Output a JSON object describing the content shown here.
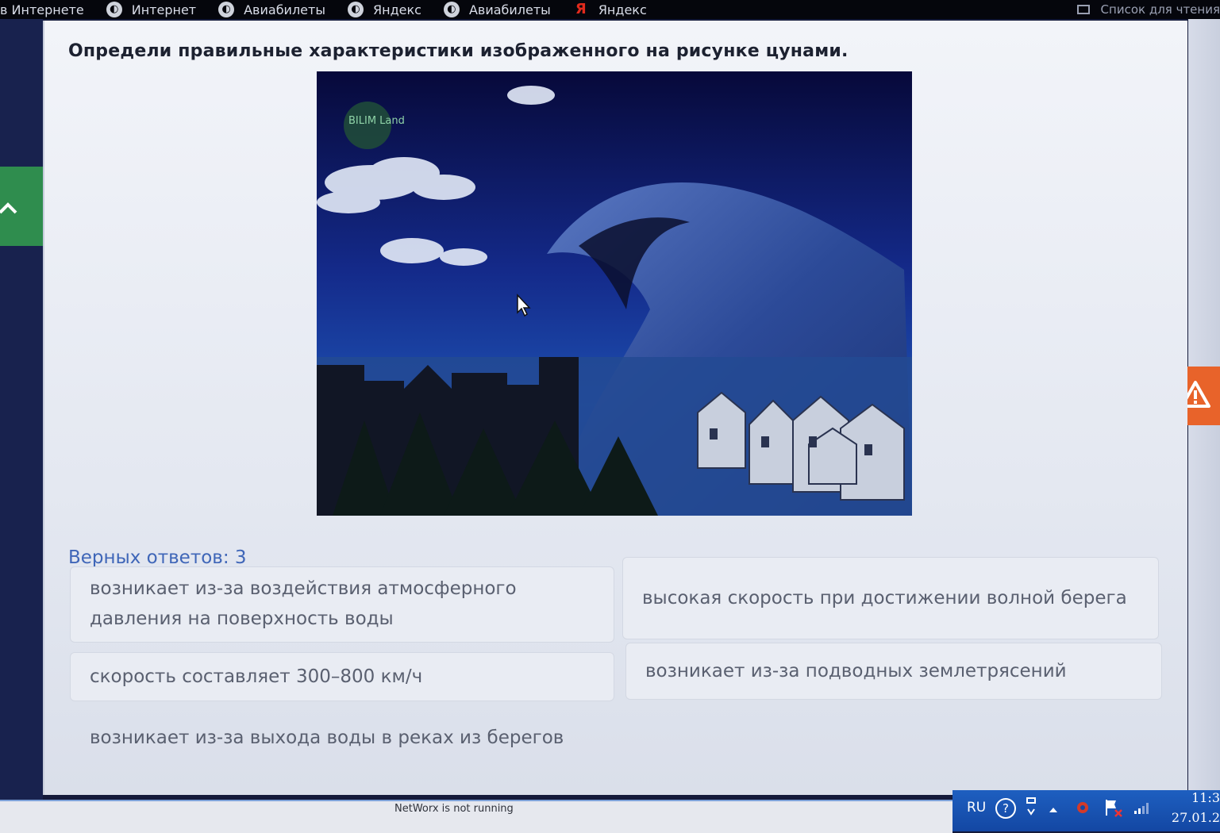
{
  "bookmarks": [
    {
      "label": "в Интернете",
      "icon": "globe-icon"
    },
    {
      "label": "Интернет",
      "icon": "globe-icon"
    },
    {
      "label": "Авиабилеты",
      "icon": "globe-icon"
    },
    {
      "label": "Яндекс",
      "icon": "globe-icon"
    },
    {
      "label": "Авиабилеты",
      "icon": "globe-icon"
    },
    {
      "label": "Яндекс",
      "icon": "yandex-icon"
    }
  ],
  "reading_list": {
    "label": "Список для чтения",
    "icon": "reading-list-icon"
  },
  "quiz": {
    "question": "Определи правильные характеристики изображенного на рисунке цунами.",
    "image_watermark": "BILIM Land",
    "correct_count": "Верных ответов: 3",
    "answers": [
      "возникает из-за воздействия атмосферного давления на поверхность воды",
      "высокая скорость при достижении волной берега",
      "скорость составляет 300–800 км/ч",
      "возникает из-за подводных землетрясений",
      "возникает из-за выхода воды в реках из берегов"
    ]
  },
  "colors": {
    "accent_green": "#2f8d4e",
    "report_orange": "#e8632a",
    "count_blue": "#3f66b8"
  },
  "statusbar": {
    "message": "NetWorx is not running"
  },
  "tray": {
    "language": "RU",
    "help": "?",
    "time": "11:3",
    "date": "27.01.2"
  }
}
